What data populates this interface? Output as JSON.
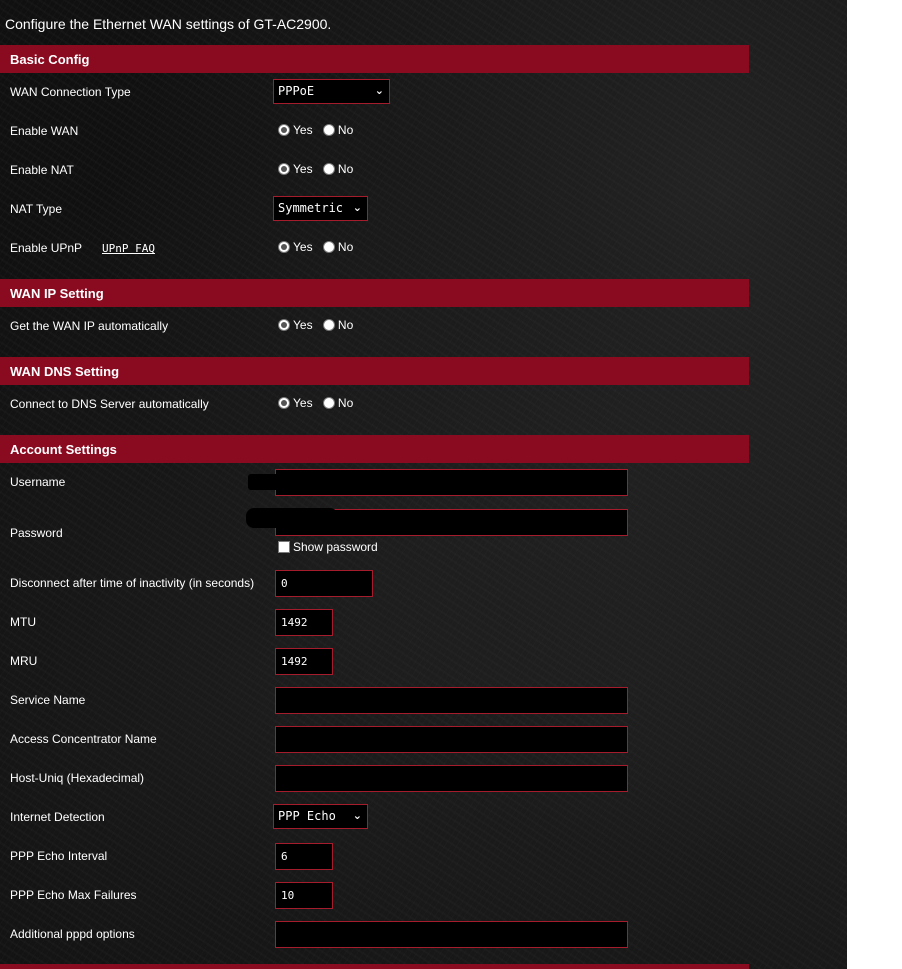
{
  "intro": "Configure the Ethernet WAN settings of GT-AC2900.",
  "sections": {
    "basic": "Basic Config",
    "wan_ip": "WAN IP Setting",
    "wan_dns": "WAN DNS Setting",
    "account": "Account Settings"
  },
  "basic": {
    "wan_type_label": "WAN Connection Type",
    "wan_type_value": "PPPoE",
    "enable_wan_label": "Enable WAN",
    "enable_nat_label": "Enable NAT",
    "nat_type_label": "NAT Type",
    "nat_type_value": "Symmetric",
    "enable_upnp_label": "Enable UPnP",
    "upnp_faq": "UPnP FAQ"
  },
  "radio": {
    "yes": "Yes",
    "no": "No"
  },
  "wan_ip": {
    "auto_label": "Get the WAN IP automatically"
  },
  "wan_dns": {
    "auto_label": "Connect to DNS Server automatically"
  },
  "account": {
    "username_label": "Username",
    "password_label": "Password",
    "show_password": "Show password",
    "idle_label": "Disconnect after time of inactivity (in seconds)",
    "idle_value": "0",
    "mtu_label": "MTU",
    "mtu_value": "1492",
    "mru_label": "MRU",
    "mru_value": "1492",
    "service_label": "Service Name",
    "service_value": "",
    "ac_label": "Access Concentrator Name",
    "ac_value": "",
    "hostuniq_label": "Host-Uniq (Hexadecimal)",
    "hostuniq_value": "",
    "detection_label": "Internet Detection",
    "detection_value": "PPP Echo",
    "echo_interval_label": "PPP Echo Interval",
    "echo_interval_value": "6",
    "echo_max_label": "PPP Echo Max Failures",
    "echo_max_value": "10",
    "pppd_label": "Additional pppd options",
    "pppd_value": ""
  },
  "icons": {
    "dropdown": "chevron-down-icon"
  },
  "colors": {
    "section_bg": "#8a0a20",
    "field_border": "#a51c2d",
    "background": "#101010"
  }
}
